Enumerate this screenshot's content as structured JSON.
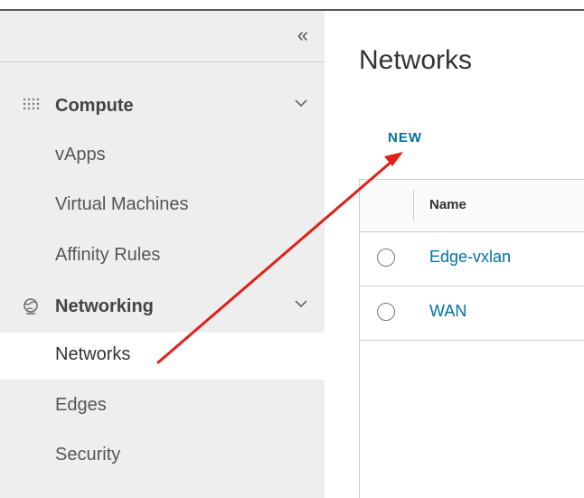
{
  "sidebar": {
    "collapse_glyph": "«",
    "groups": [
      {
        "label": "Compute",
        "icon": "grid-dots-icon",
        "items": [
          {
            "label": "vApps"
          },
          {
            "label": "Virtual Machines"
          },
          {
            "label": "Affinity Rules"
          }
        ]
      },
      {
        "label": "Networking",
        "icon": "network-globe-icon",
        "items": [
          {
            "label": "Networks",
            "active": true
          },
          {
            "label": "Edges"
          },
          {
            "label": "Security"
          }
        ]
      }
    ]
  },
  "main": {
    "title": "Networks",
    "new_label": "NEW",
    "grid": {
      "column_name": "Name",
      "rows": [
        {
          "name": "Edge-vxlan"
        },
        {
          "name": "WAN"
        }
      ]
    }
  },
  "annotation": {
    "type": "arrow",
    "color": "#e0201b",
    "from": "sidebar-item-networks",
    "to": "new-button"
  }
}
